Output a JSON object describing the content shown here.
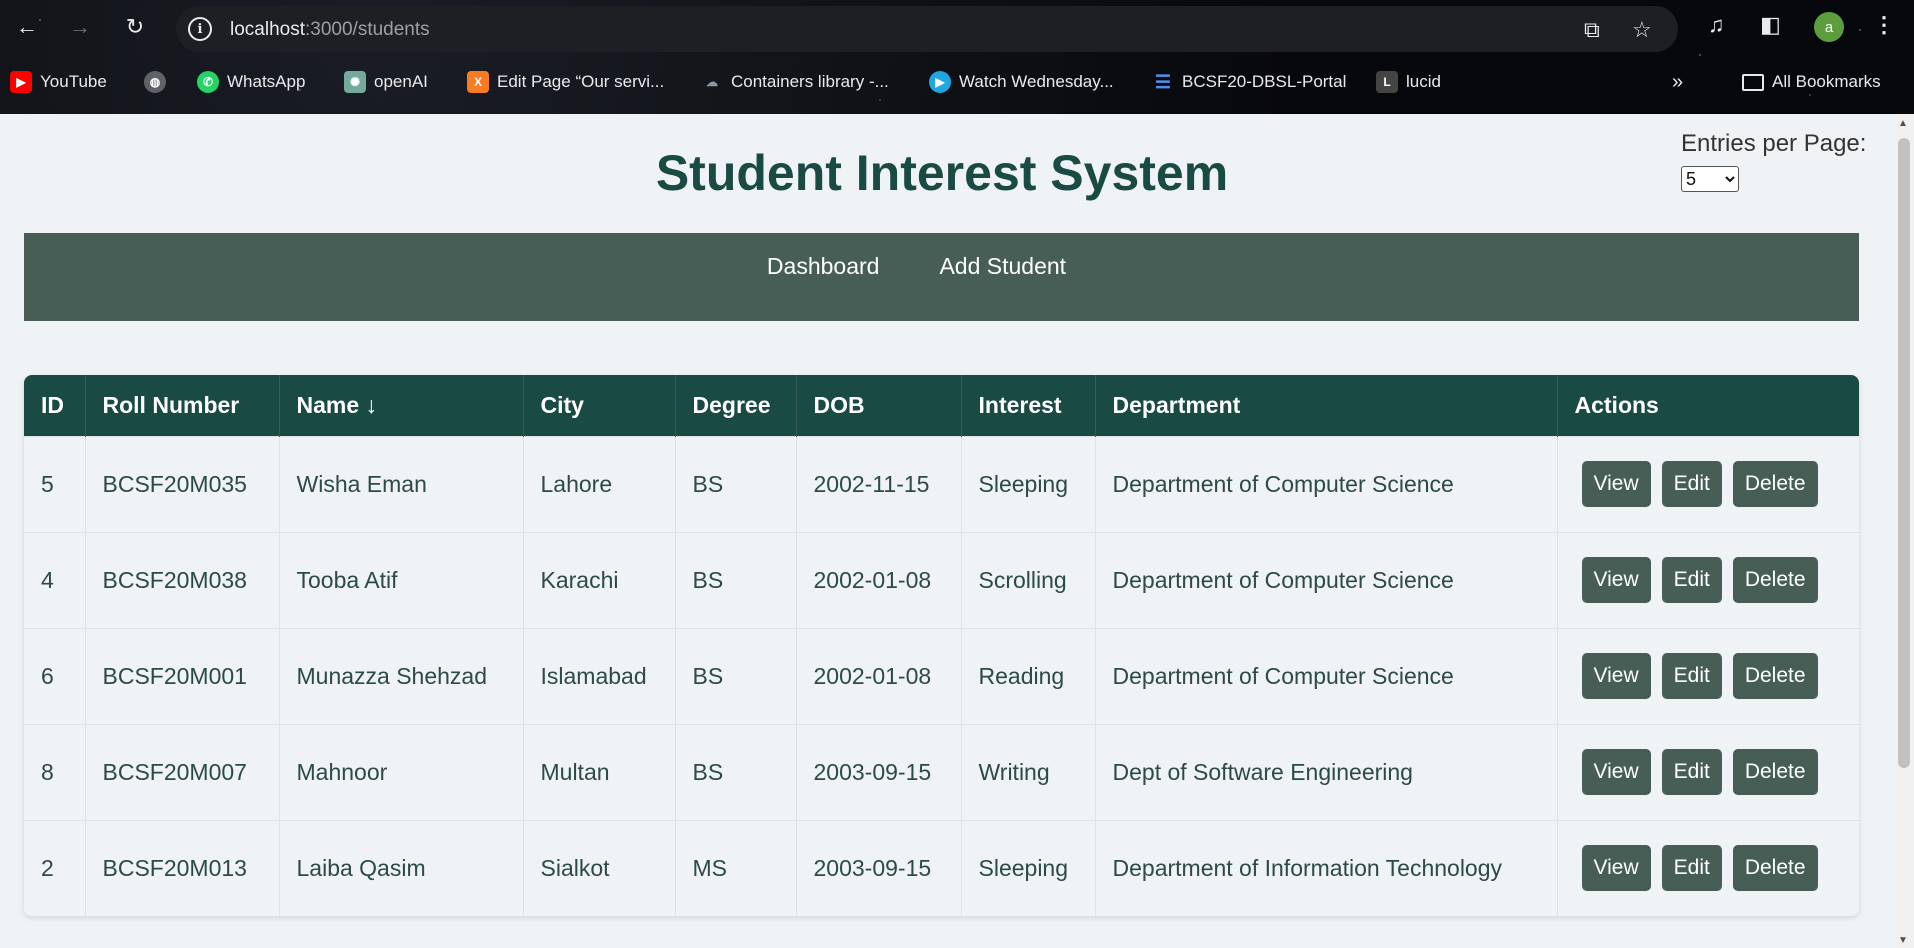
{
  "browser": {
    "url_host": "localhost",
    "url_path": ":3000/students",
    "avatar_letter": "a",
    "bookmarks": [
      {
        "label": "YouTube",
        "icon": "youtube-icon",
        "color": "#ff0000"
      },
      {
        "label": "",
        "icon": "globe-icon",
        "color": "#9aa0a6"
      },
      {
        "label": "WhatsApp",
        "icon": "whatsapp-icon",
        "color": "#25d366"
      },
      {
        "label": "openAI",
        "icon": "openai-icon",
        "color": "#74aa9c"
      },
      {
        "label": "Edit Page “Our servi...",
        "icon": "xampp-icon",
        "color": "#fb7a24"
      },
      {
        "label": "Containers library -...",
        "icon": "docker-icon",
        "color": "#5a6b80"
      },
      {
        "label": "Watch Wednesday...",
        "icon": "play-icon",
        "color": "#1ea7e1"
      },
      {
        "label": "BCSF20-DBSL-Portal",
        "icon": "database-icon",
        "color": "#4f8ff0"
      },
      {
        "label": "lucid",
        "icon": "lucid-icon",
        "color": "#444"
      }
    ],
    "all_bookmarks_label": "All Bookmarks"
  },
  "header": {
    "title": "Student Interest System",
    "entries_label": "Entries per Page:",
    "entries_value": "5"
  },
  "nav": {
    "items": [
      "Dashboard",
      "Add Student"
    ]
  },
  "table": {
    "columns": [
      "ID",
      "Roll Number",
      "Name ↓",
      "City",
      "Degree",
      "DOB",
      "Interest",
      "Department",
      "Actions"
    ],
    "rows": [
      [
        "5",
        "BCSF20M035",
        "Wisha Eman",
        "Lahore",
        "BS",
        "2002-11-15",
        "Sleeping",
        "Department of Computer Science"
      ],
      [
        "4",
        "BCSF20M038",
        "Tooba Atif",
        "Karachi",
        "BS",
        "2002-01-08",
        "Scrolling",
        "Department of Computer Science"
      ],
      [
        "6",
        "BCSF20M001",
        "Munazza Shehzad",
        "Islamabad",
        "BS",
        "2002-01-08",
        "Reading",
        "Department of Computer Science"
      ],
      [
        "8",
        "BCSF20M007",
        "Mahnoor",
        "Multan",
        "BS",
        "2003-09-15",
        "Writing",
        "Dept of Software Engineering"
      ],
      [
        "2",
        "BCSF20M013",
        "Laiba Qasim",
        "Sialkot",
        "MS",
        "2003-09-15",
        "Sleeping",
        "Department of Information Technology"
      ]
    ],
    "action_labels": [
      "View",
      "Edit",
      "Delete"
    ]
  },
  "colors": {
    "primary": "#1a4a44",
    "nav_bg": "#475e56",
    "page_bg": "#f0f3f6"
  }
}
